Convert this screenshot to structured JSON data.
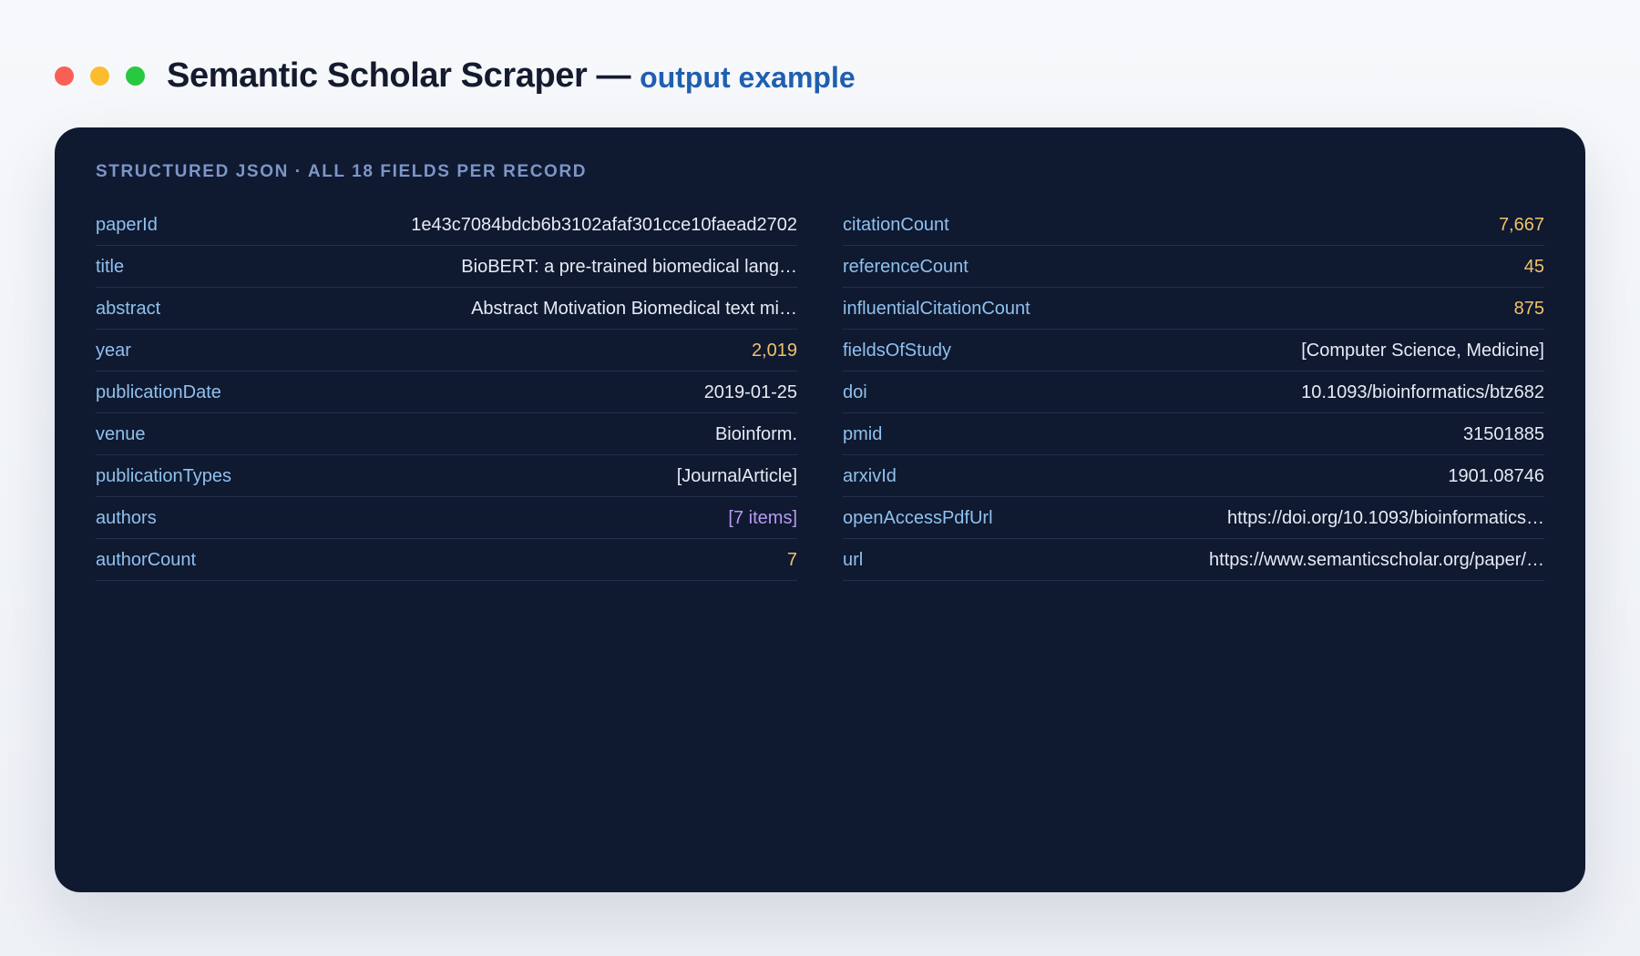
{
  "window": {
    "title": "Semantic Scholar Scraper —",
    "subtitle": "output example"
  },
  "card": {
    "section_label": "STRUCTURED JSON · ALL 18 FIELDS PER RECORD"
  },
  "fields_left": [
    {
      "key": "paperId",
      "value": "1e43c7084bdcb6b3102afaf301cce10faead2702",
      "type": "string"
    },
    {
      "key": "title",
      "value": "BioBERT: a pre-trained biomedical lang…",
      "type": "string"
    },
    {
      "key": "abstract",
      "value": "Abstract Motivation Biomedical text mi…",
      "type": "string"
    },
    {
      "key": "year",
      "value": "2,019",
      "type": "number"
    },
    {
      "key": "publicationDate",
      "value": "2019-01-25",
      "type": "string"
    },
    {
      "key": "venue",
      "value": "Bioinform.",
      "type": "string"
    },
    {
      "key": "publicationTypes",
      "value": "[JournalArticle]",
      "type": "string"
    },
    {
      "key": "authors",
      "value": "[7 items]",
      "type": "array"
    },
    {
      "key": "authorCount",
      "value": "7",
      "type": "number"
    }
  ],
  "fields_right": [
    {
      "key": "citationCount",
      "value": "7,667",
      "type": "number"
    },
    {
      "key": "referenceCount",
      "value": "45",
      "type": "number"
    },
    {
      "key": "influentialCitationCount",
      "value": "875",
      "type": "number"
    },
    {
      "key": "fieldsOfStudy",
      "value": "[Computer Science, Medicine]",
      "type": "string"
    },
    {
      "key": "doi",
      "value": "10.1093/bioinformatics/btz682",
      "type": "string"
    },
    {
      "key": "pmid",
      "value": "31501885",
      "type": "string"
    },
    {
      "key": "arxivId",
      "value": "1901.08746",
      "type": "string"
    },
    {
      "key": "openAccessPdfUrl",
      "value": "https://doi.org/10.1093/bioinformatics…",
      "type": "string"
    },
    {
      "key": "url",
      "value": "https://www.semanticscholar.org/paper/…",
      "type": "string"
    }
  ],
  "colors": {
    "dot_close": "#fa5f57",
    "dot_minimize": "#fdbc2e",
    "dot_maximize": "#28c840",
    "card_background": "#0f1930",
    "key": "#8fc1ee",
    "string_value": "#e6ebf4",
    "number_value": "#f1c26a",
    "array_value": "#b79af0",
    "subtitle": "#1f5fb0"
  }
}
